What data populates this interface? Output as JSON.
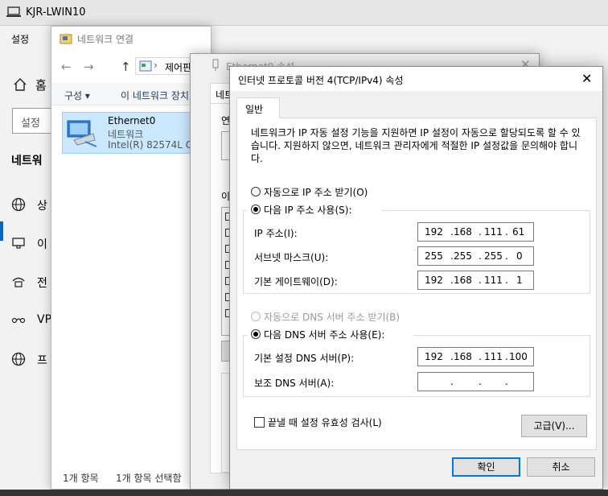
{
  "vm": {
    "title": "KJR-LWIN10"
  },
  "settings": {
    "app_title": "설정",
    "home": "홈",
    "search_placeholder": "설정",
    "section": "네트워",
    "nav": [
      {
        "label": "상",
        "icon": "globe-icon"
      },
      {
        "label": "이",
        "icon": "ethernet-icon"
      },
      {
        "label": "전",
        "icon": "dialup-icon"
      },
      {
        "label": "VP",
        "icon": "vpn-icon"
      },
      {
        "label": "프",
        "icon": "proxy-globe-icon"
      }
    ]
  },
  "netwin": {
    "title": "네트워크 연결",
    "address": "제어판",
    "cmd_organize": "구성 ▾",
    "cmd_device": "이 네트워크 장치",
    "item": {
      "name": "Ethernet0",
      "type": "네트워크",
      "adapter": "Intel(R) 82574L Gig"
    },
    "status_count": "1개 항목",
    "status_selected": "1개 항목 선택함"
  },
  "ethwin": {
    "title": "Ethernet0 속성",
    "tab": "네트",
    "label_connect": "연",
    "label_items": "이"
  },
  "dialog": {
    "title": "인터넷 프로토콜 버전 4(TCP/IPv4) 속성",
    "close": "✕",
    "tab": "일반",
    "description": "네트워크가 IP 자동 설정 기능을 지원하면 IP 설정이 자동으로 할당되도록 할 수 있습니다. 지원하지 않으면, 네트워크 관리자에게 적절한 IP 설정값을 문의해야 합니다.",
    "auto_ip": "자동으로 IP 주소 받기(O)",
    "manual_ip": "다음 IP 주소 사용(S):",
    "ip_label": "IP 주소(I):",
    "ip": [
      "192",
      "168",
      "111",
      "61"
    ],
    "mask_label": "서브넷 마스크(U):",
    "mask": [
      "255",
      "255",
      "255",
      "0"
    ],
    "gw_label": "기본 게이트웨이(D):",
    "gw": [
      "192",
      "168",
      "111",
      "1"
    ],
    "auto_dns": "자동으로 DNS 서버 주소 받기(B)",
    "manual_dns": "다음 DNS 서버 주소 사용(E):",
    "dns1_label": "기본 설정 DNS 서버(P):",
    "dns1": [
      "192",
      "168",
      "111",
      "100"
    ],
    "dns2_label": "보조 DNS 서버(A):",
    "dns2": [
      "",
      "",
      "",
      ""
    ],
    "validate": "끝낼 때 설정 유효성 검사(L)",
    "advanced": "고급(V)...",
    "ok": "확인",
    "cancel": "취소"
  }
}
